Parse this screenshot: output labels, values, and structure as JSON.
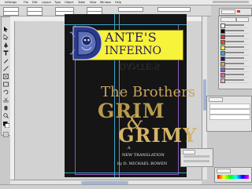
{
  "menu": {
    "app": "InDesign",
    "items": [
      "File",
      "Edit",
      "Layout",
      "Type",
      "Object",
      "Table",
      "View",
      "Window",
      "Help"
    ]
  },
  "document": {
    "title_line1": "ANTE'S",
    "title_line2": "INFERNO",
    "title_mirror": "DANTE'S",
    "brothers": "The Brothers",
    "grim": "GRIM",
    "ampersand": "&",
    "grimy": "GRIMY",
    "a": "A",
    "new_translation": "NEW TRANSLATION",
    "by_author": "by D. MICHAEL BOWEN"
  },
  "colors": {
    "page": "#151515",
    "banner": "#f7f23a",
    "title_ink": "#2a1d57",
    "gold": "#c9a35c",
    "guide": "#3fa0c8",
    "margin": "#8a5cc0"
  },
  "icons": {
    "selection": "arrow-icon",
    "type": "type-tool-icon",
    "pen": "pen-tool-icon",
    "zoom": "zoom-icon"
  }
}
